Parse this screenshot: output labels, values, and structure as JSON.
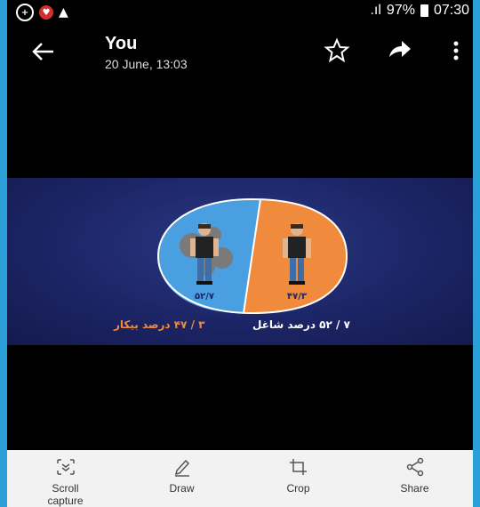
{
  "statusbar": {
    "signal": ".ıl",
    "battery": "97%",
    "time": "07:30"
  },
  "header": {
    "title": "You",
    "subtitle": "20 June, 13:03"
  },
  "image": {
    "left_label": "۵۲/۷",
    "right_label": "۴۷/۳",
    "caption_right": "۷ / ۵۲ درصد شاغل",
    "caption_left": "۳ / ۴۷ درصد بیکار"
  },
  "toolbar": {
    "scroll": "Scroll\ncapture",
    "draw": "Draw",
    "crop": "Crop",
    "share": "Share"
  },
  "colors": {
    "accent": "#2d9fd8",
    "pie_blue": "#4a9fe0",
    "pie_orange": "#f08a3c"
  }
}
